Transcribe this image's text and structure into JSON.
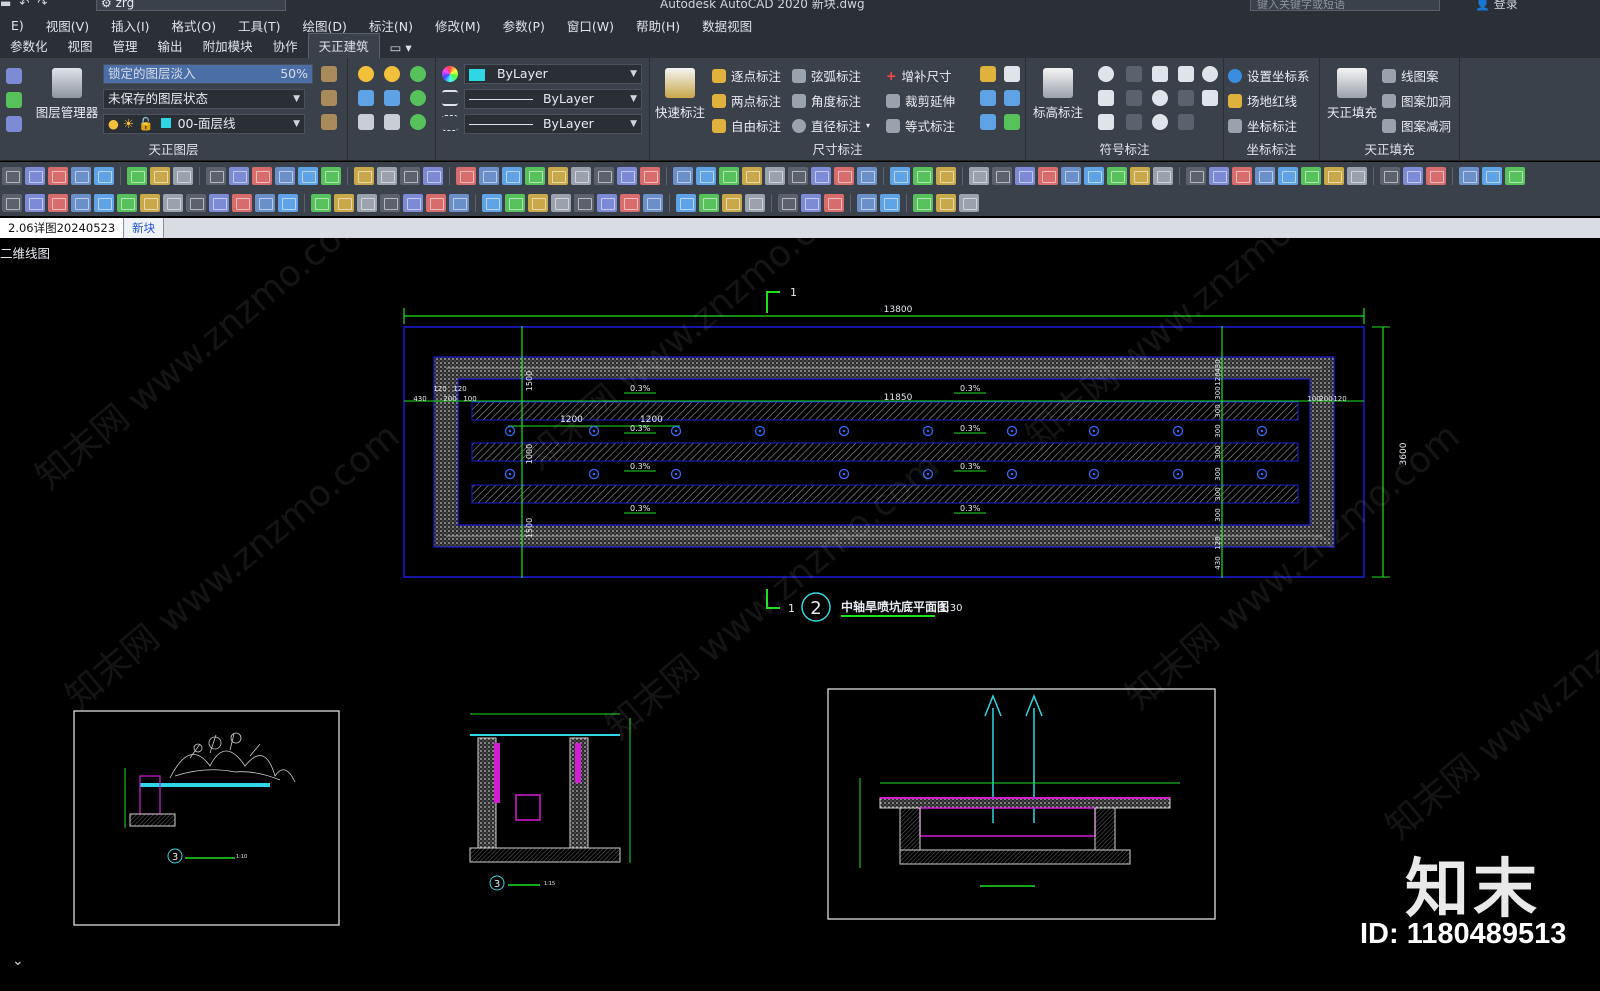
{
  "titlebar": {
    "workspace": "zrg",
    "app_title": "Autodesk AutoCAD 2020    新块.dwg",
    "search_placeholder": "键入关键字或短语",
    "login": "登录"
  },
  "menubar": [
    "E)",
    "视图(V)",
    "插入(I)",
    "格式(O)",
    "工具(T)",
    "绘图(D)",
    "标注(N)",
    "修改(M)",
    "参数(P)",
    "窗口(W)",
    "帮助(H)",
    "数据视图"
  ],
  "ribbon_tabs": [
    "参数化",
    "视图",
    "管理",
    "输出",
    "附加模块",
    "协作",
    "天正建筑"
  ],
  "ribbon_active_tab": "天正建筑",
  "ribbon": {
    "layer_panel": {
      "title": "天正图层",
      "layer_manager": "图层管理器",
      "lock_fade_label": "锁定的图层淡入",
      "lock_fade_value": "50%",
      "layer_state": "未保存的图层状态",
      "current_layer": "00-面层线"
    },
    "props": {
      "color": "ByLayer",
      "linetype": "ByLayer",
      "lineweight": "ByLayer"
    },
    "dim_panel": {
      "title": "尺寸标注",
      "quick_dim": "快速标注",
      "items": [
        "逐点标注",
        "弦弧标注",
        "增补尺寸",
        "两点标注",
        "角度标注",
        "裁剪延伸",
        "自由标注",
        "直径标注",
        "等式标注"
      ]
    },
    "symbol_panel": {
      "title": "符号标注",
      "elev": "标高标注"
    },
    "coord_panel": {
      "title": "坐标标注",
      "items": [
        "设置坐标系",
        "场地红线",
        "坐标标注"
      ]
    },
    "fill_panel": {
      "title": "天正填充",
      "big": "天正填充",
      "items": [
        "线图案",
        "图案加洞",
        "图案减洞"
      ]
    }
  },
  "file_tabs": {
    "current": "2.06详图20240523",
    "new": "新块"
  },
  "viewport_label": "二维线图",
  "drawing": {
    "plan_title": "中轴旱喷坑底平面图",
    "plan_number": "2",
    "plan_scale": "1:30",
    "section_mark": "1",
    "overall_width": "13800",
    "inner_width": "11850",
    "height_dim": "3600",
    "dim_1200a": "1200",
    "dim_1200b": "1200",
    "slope": "0.3%",
    "left_dims": [
      "430",
      "120",
      "200",
      "100",
      "120"
    ],
    "right_dims": [
      "100",
      "200",
      "120"
    ],
    "right_vertical_dims": [
      "430",
      "120",
      "300",
      "300",
      "300",
      "300",
      "300",
      "300",
      "300",
      "120",
      "430"
    ],
    "left_vertical_dims": [
      "1500",
      "1000",
      "1500"
    ],
    "detail_left_number": "3",
    "detail_mid_number": "3",
    "detail_mid_scale": "1:15",
    "detail_left_scale": "1:10"
  },
  "watermark": "知末网 www.znzmo.com",
  "brand": {
    "logo": "知末",
    "id": "ID: 1180489513"
  },
  "colors": {
    "ui_bg": "#3b414b",
    "dim_green": "#1ee01e",
    "outline_blue": "#1c1cd8",
    "hatch_grey": "#9a9a9a",
    "circle_blue": "#2f6cff",
    "text_white": "#e8ecf2",
    "magenta": "#d21ed2",
    "cyan": "#2fd7e6"
  }
}
